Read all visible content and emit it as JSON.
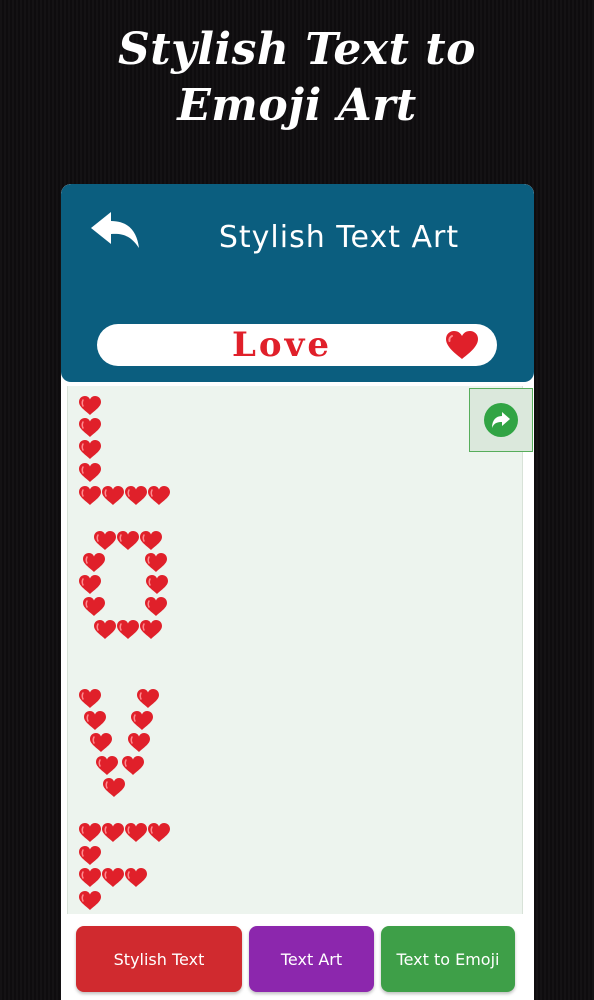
{
  "promo": {
    "title_line1": "Stylish Text to",
    "title_line2": "Emoji Art"
  },
  "header": {
    "back_icon": "back-arrow-icon",
    "title": "Stylish Text Art"
  },
  "input": {
    "value": "Love",
    "emoji": "❤️",
    "emoji_icon": "red-heart-icon"
  },
  "canvas": {
    "share_icon": "share-icon",
    "art_word": "Love",
    "art_emoji": "heart-icon",
    "art_color": "#e0202a"
  },
  "tabs": [
    {
      "label": "Stylish Text",
      "color": "#d02a2f"
    },
    {
      "label": "Text Art",
      "color": "#8c27ad"
    },
    {
      "label": "Text to Emoji",
      "color": "#3e9f48"
    }
  ],
  "colors": {
    "header_bg": "#0b5e7f",
    "canvas_bg": "#edf4ee",
    "accent_green": "#31a444"
  }
}
